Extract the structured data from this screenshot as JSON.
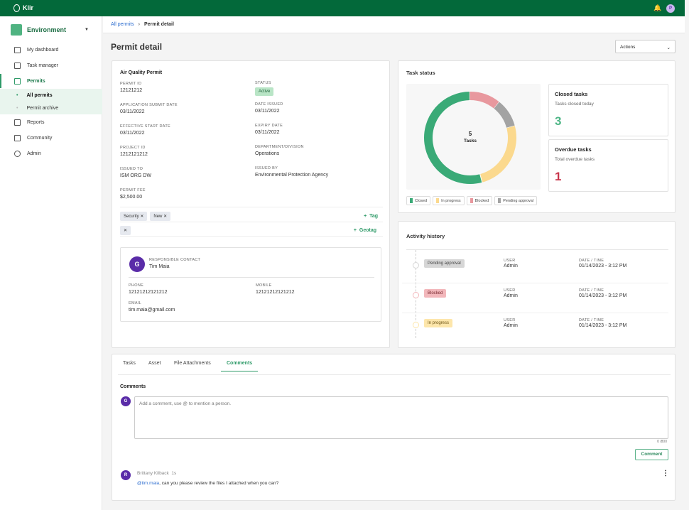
{
  "app": {
    "name": "Klir",
    "user_initial": "P"
  },
  "sidebar": {
    "workspace": "Environment",
    "items": [
      {
        "label": "My dashboard",
        "icon": "dashboard-icon"
      },
      {
        "label": "Task manager",
        "icon": "task-icon"
      },
      {
        "label": "Permits",
        "icon": "permit-icon",
        "active": true
      },
      {
        "label": "All permits",
        "sub": true,
        "active": true
      },
      {
        "label": "Permit archive",
        "sub": true
      },
      {
        "label": "Reports",
        "icon": "report-icon"
      },
      {
        "label": "Community",
        "icon": "community-icon"
      },
      {
        "label": "Admin",
        "icon": "gear-icon"
      }
    ]
  },
  "breadcrumb": {
    "parent": "All permits",
    "current": "Permit detail"
  },
  "page": {
    "title": "Permit detail",
    "actions_label": "Actions"
  },
  "permit": {
    "title": "Air Quality Permit",
    "fields_left": [
      {
        "label": "Permit ID",
        "value": "12121212"
      },
      {
        "label": "Application submit date",
        "value": "03/11/2022"
      },
      {
        "label": "Effective start date",
        "value": "03/11/2022"
      },
      {
        "label": "Project ID",
        "value": "1212121212"
      },
      {
        "label": "Issued to",
        "value": "ISM ORG DW"
      },
      {
        "label": "Permit fee",
        "value": "$2,500.00"
      }
    ],
    "status_label": "Status",
    "status": "Active",
    "fields_right": [
      {
        "label": "Date issued",
        "value": "03/11/2022"
      },
      {
        "label": "Expiry date",
        "value": "03/11/2022"
      },
      {
        "label": "Department/Division",
        "value": "Operations"
      },
      {
        "label": "Issued by",
        "value": "Environmental Protection Agency"
      }
    ],
    "tags": [
      "Security",
      "New"
    ],
    "add_tag": "Tag",
    "add_geotag": "Geotag",
    "contact": {
      "initial": "G",
      "label": "Responsible contact",
      "name": "Tim Maia",
      "phone_label": "Phone",
      "phone": "12121212121212",
      "mobile_label": "Mobile",
      "mobile": "12121212121212",
      "email_label": "Email",
      "email": "tim.maia@gmail.com"
    }
  },
  "task_status": {
    "title": "Task status",
    "total": "5",
    "total_label": "Tasks",
    "closed": {
      "title": "Closed tasks",
      "subtitle": "Tasks closed today",
      "value": "3"
    },
    "overdue": {
      "title": "Overdue tasks",
      "subtitle": "Total overdue tasks",
      "value": "1"
    }
  },
  "chart_data": {
    "type": "pie",
    "donut": true,
    "center_text": "5 Tasks",
    "legend": [
      "Closed",
      "In progress",
      "Blocked",
      "Pending approval"
    ],
    "series": [
      {
        "name": "Closed",
        "share_pct": 54,
        "color": "#3aaa77"
      },
      {
        "name": "Blocked",
        "share_pct": 11,
        "color": "#e8989e"
      },
      {
        "name": "Pending approval",
        "share_pct": 10,
        "color": "#a3a3a3"
      },
      {
        "name": "In progress",
        "share_pct": 25,
        "color": "#fbd98e"
      }
    ],
    "legend_placement": "bottom"
  },
  "activity": {
    "title": "Activity history",
    "user_label": "User",
    "date_label": "Date / Time",
    "rows": [
      {
        "status": "Pending approval",
        "user": "Admin",
        "date": "01/14/2023 - 3:12 PM",
        "bg": "#d6d6d6",
        "fg": "#444"
      },
      {
        "status": "Blocked",
        "user": "Admin",
        "date": "01/14/2023 - 3:12 PM",
        "bg": "#f2b7bb",
        "fg": "#7a2a30"
      },
      {
        "status": "In progress",
        "user": "Admin",
        "date": "01/14/2023 - 3:12 PM",
        "bg": "#fde6ab",
        "fg": "#6b5314"
      }
    ]
  },
  "tabs": [
    "Tasks",
    "Asset",
    "File Attachments",
    "Comments"
  ],
  "comments": {
    "title": "Comments",
    "user_initial": "G",
    "placeholder": "Add a comment, use @ to mention a person.",
    "counter": "0 /800",
    "submit": "Comment",
    "items": [
      {
        "initial": "R",
        "author": "Brittany Kilback",
        "time": "1s",
        "mention": "@tim.maia",
        "text": ", can you please review the files I attached when you can?"
      }
    ]
  },
  "colors": {
    "brand": "#03693a",
    "accent": "#2e9a68",
    "overdue": "#c8344a"
  }
}
